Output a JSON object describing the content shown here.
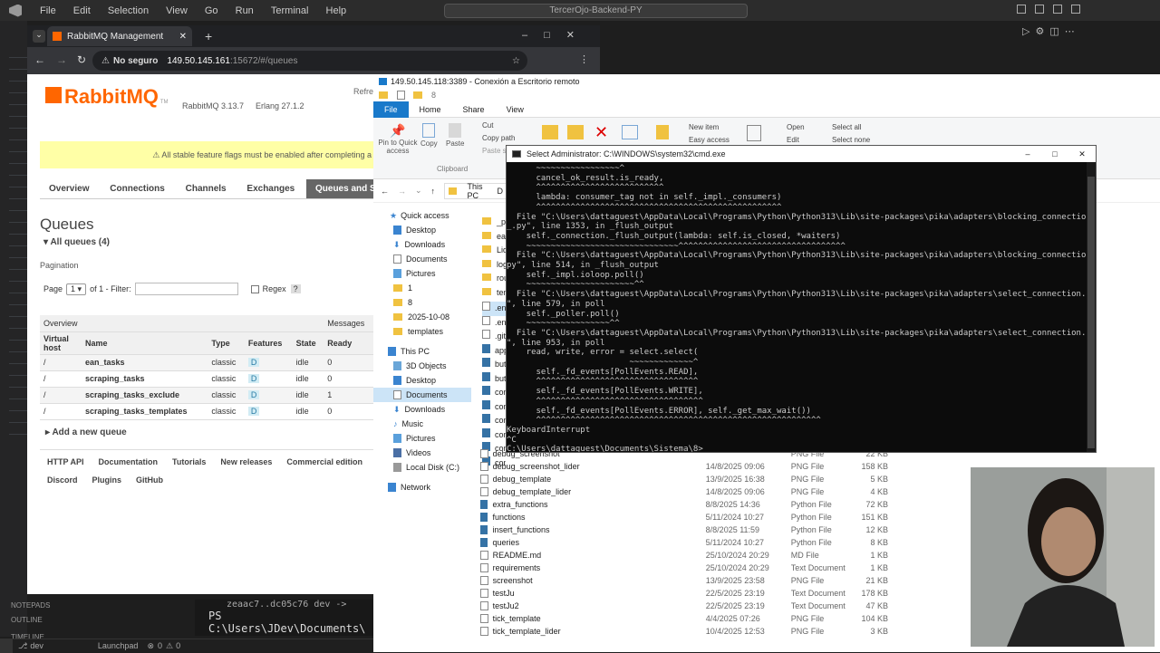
{
  "vscode": {
    "menu": [
      "File",
      "Edit",
      "Selection",
      "View",
      "Go",
      "Run",
      "Terminal",
      "Help"
    ],
    "search_text": "TercerOjo-Backend-PY",
    "terminal_lines": [
      "zeaac7..dc05c76  dev ->",
      "PS C:\\Users\\JDev\\Documents\\"
    ],
    "side_labels": [
      "NOTEPADS",
      "OUTLINE",
      "TIMELINE"
    ],
    "status": {
      "branch": "dev",
      "launchpad": "Launchpad",
      "problems": "0",
      "warnings": "0"
    }
  },
  "chrome": {
    "tab_title": "RabbitMQ Management",
    "security": "No seguro",
    "url_host": "149.50.145.161",
    "url_rest": ":15672/#/queues"
  },
  "rabbitmq": {
    "logo": "RabbitMQ",
    "tm": "TM",
    "version": "RabbitMQ 3.13.7",
    "erlang": "Erlang 27.1.2",
    "refresh": "Refre",
    "warning": "⚠ All stable feature flags must be enabled after completing a",
    "nav": [
      "Overview",
      "Connections",
      "Channels",
      "Exchanges",
      "Queues and Str"
    ],
    "page_title": "Queues",
    "all_queues": "All queues (4)",
    "pagination": "Pagination",
    "page_label": "Page",
    "page_value": "1",
    "of_label": "of 1  - Filter:",
    "regex_label": "Regex",
    "regex_help": "?",
    "group_overview": "Overview",
    "group_messages": "Messages",
    "columns": [
      "Virtual host",
      "Name",
      "Type",
      "Features",
      "State",
      "Ready"
    ],
    "rows": [
      {
        "vhost": "/",
        "name": "ean_tasks",
        "type": "classic",
        "feature": "D",
        "state": "idle",
        "ready": "0"
      },
      {
        "vhost": "/",
        "name": "scraping_tasks",
        "type": "classic",
        "feature": "D",
        "state": "idle",
        "ready": "0"
      },
      {
        "vhost": "/",
        "name": "scraping_tasks_exclude",
        "type": "classic",
        "feature": "D",
        "state": "idle",
        "ready": "1"
      },
      {
        "vhost": "/",
        "name": "scraping_tasks_templates",
        "type": "classic",
        "feature": "D",
        "state": "idle",
        "ready": "0"
      }
    ],
    "add_queue": "Add a new queue",
    "footer": [
      "HTTP API",
      "Documentation",
      "Tutorials",
      "New releases",
      "Commercial edition",
      "Discord",
      "Plugins",
      "GitHub"
    ]
  },
  "explorer": {
    "rdp_title": "149.50.145.118:3389 - Conexión a Escritorio remoto",
    "qat": "8",
    "tabs": [
      "File",
      "Home",
      "Share",
      "View"
    ],
    "ribbon": {
      "pin": "Pin to Quick access",
      "copy": "Copy",
      "paste": "Paste",
      "cut": "Cut",
      "copy_path": "Copy path",
      "paste_sc": "Paste s",
      "clipboard": "Clipboard",
      "new_item": "New item",
      "easy_access": "Easy access",
      "open": "Open",
      "edit": "Edit",
      "select_all": "Select all",
      "select_none": "Select none"
    },
    "crumb_pc": "This PC",
    "crumb_d": "D",
    "nav": [
      "Quick access",
      "Desktop",
      "Downloads",
      "Documents",
      "Pictures",
      "1",
      "8",
      "2025-10-08",
      "templates",
      "This PC",
      "3D Objects",
      "Desktop",
      "Documents",
      "Downloads",
      "Music",
      "Pictures",
      "Videos",
      "Local Disk (C:)",
      "Network"
    ],
    "partial_items": [
      "_py",
      "ean",
      "Lide",
      "logs",
      "rout",
      "tem",
      ".env",
      ".env",
      ".giti",
      "app",
      "but",
      "but",
      "con",
      "con",
      "con",
      "con",
      "con",
      "con"
    ],
    "files": [
      {
        "name": "debug_screenshot",
        "date": "",
        "type": "PNG File",
        "size": "22 KB",
        "icon": "doc"
      },
      {
        "name": "debug_screenshot_lider",
        "date": "14/8/2025 09:06",
        "type": "PNG File",
        "size": "158 KB",
        "icon": "doc"
      },
      {
        "name": "debug_template",
        "date": "13/9/2025 16:38",
        "type": "PNG File",
        "size": "5 KB",
        "icon": "doc"
      },
      {
        "name": "debug_template_lider",
        "date": "14/8/2025 09:06",
        "type": "PNG File",
        "size": "4 KB",
        "icon": "doc"
      },
      {
        "name": "extra_functions",
        "date": "8/8/2025 14:36",
        "type": "Python File",
        "size": "72 KB",
        "icon": "py"
      },
      {
        "name": "functions",
        "date": "5/11/2024 10:27",
        "type": "Python File",
        "size": "151 KB",
        "icon": "py"
      },
      {
        "name": "insert_functions",
        "date": "8/8/2025 11:59",
        "type": "Python File",
        "size": "12 KB",
        "icon": "py"
      },
      {
        "name": "queries",
        "date": "5/11/2024 10:27",
        "type": "Python File",
        "size": "8 KB",
        "icon": "py"
      },
      {
        "name": "README.md",
        "date": "25/10/2024 20:29",
        "type": "MD File",
        "size": "1 KB",
        "icon": "doc"
      },
      {
        "name": "requirements",
        "date": "25/10/2024 20:29",
        "type": "Text Document",
        "size": "1 KB",
        "icon": "doc"
      },
      {
        "name": "screenshot",
        "date": "13/9/2025 23:58",
        "type": "PNG File",
        "size": "21 KB",
        "icon": "doc"
      },
      {
        "name": "testJu",
        "date": "22/5/2025 23:19",
        "type": "Text Document",
        "size": "178 KB",
        "icon": "doc"
      },
      {
        "name": "testJu2",
        "date": "22/5/2025 23:19",
        "type": "Text Document",
        "size": "47 KB",
        "icon": "doc"
      },
      {
        "name": "tick_template",
        "date": "4/4/2025 07:26",
        "type": "PNG File",
        "size": "104 KB",
        "icon": "doc"
      },
      {
        "name": "tick_template_lider",
        "date": "10/4/2025 12:53",
        "type": "PNG File",
        "size": "3 KB",
        "icon": "doc"
      }
    ]
  },
  "cmd": {
    "title": "Select Administrator: C:\\WINDOWS\\system32\\cmd.exe",
    "lines": [
      "      ~~~~~~~~~~~~~~~~~^",
      "      cancel_ok_result.is_ready,",
      "      ^^^^^^^^^^^^^^^^^^^^^^^^^^",
      "      lambda: consumer_tag not in self._impl._consumers)",
      "      ^^^^^^^^^^^^^^^^^^^^^^^^^^^^^^^^^^^^^^^^^^^^^^^^^^",
      "  File \"C:\\Users\\dattaguest\\AppData\\Local\\Programs\\Python\\Python313\\Lib\\site-packages\\pika\\adapters\\blocking_connection.",
      "_.py\", line 1353, in _flush_output",
      "    self._connection._flush_output(lambda: self.is_closed, *waiters)",
      "    ~~~~~~~~~~~~~~~~~~~~~~~~~~~~~~~^^^^^^^^^^^^^^^^^^^^^^^^^^^^^^^^^^",
      "  File \"C:\\Users\\dattaguest\\AppData\\Local\\Programs\\Python\\Python313\\Lib\\site-packages\\pika\\adapters\\blocking_connection.",
      "py\", line 514, in _flush_output",
      "    self._impl.ioloop.poll()",
      "    ~~~~~~~~~~~~~~~~~~~~~~^^",
      "  File \"C:\\Users\\dattaguest\\AppData\\Local\\Programs\\Python\\Python313\\Lib\\site-packages\\pika\\adapters\\select_connection.py",
      "\", line 579, in poll",
      "    self._poller.poll()",
      "    ~~~~~~~~~~~~~~~~~^^",
      "  File \"C:\\Users\\dattaguest\\AppData\\Local\\Programs\\Python\\Python313\\Lib\\site-packages\\pika\\adapters\\select_connection.py",
      "\", line 953, in poll",
      "    read, write, error = select.select(",
      "                         ~~~~~~~~~~~~~^",
      "      self._fd_events[PollEvents.READ],",
      "      ^^^^^^^^^^^^^^^^^^^^^^^^^^^^^^^^^",
      "      self._fd_events[PollEvents.WRITE],",
      "      ^^^^^^^^^^^^^^^^^^^^^^^^^^^^^^^^^^",
      "      self._fd_events[PollEvents.ERROR], self._get_max_wait())",
      "      ^^^^^^^^^^^^^^^^^^^^^^^^^^^^^^^^^^^^^^^^^^^^^^^^^^^^^^^^^^",
      "KeyboardInterrupt",
      "^C",
      "C:\\Users\\dattaguest\\Documents\\Sistema\\8>"
    ]
  },
  "colors": {
    "rmq_orange": "#f60",
    "warning_bg": "#ffffa6",
    "explorer_blue": "#1979ca",
    "cmd_bg": "#0c0c0c"
  }
}
